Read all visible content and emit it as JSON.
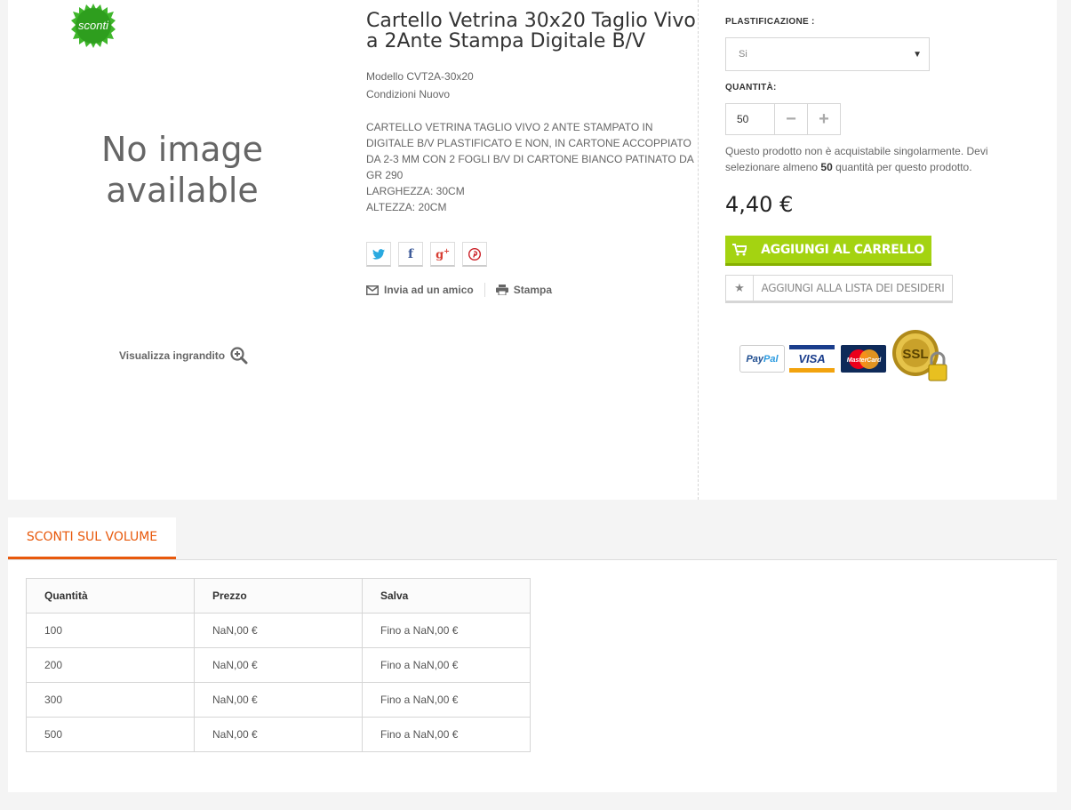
{
  "product": {
    "badge_text": "sconti",
    "no_image_line1": "No image",
    "no_image_line2": "available",
    "zoom_label": "Visualizza ingrandito",
    "title": "Cartello Vetrina 30x20 Taglio Vivo a 2Ante Stampa Digitale B/V",
    "model": "Modello CVT2A-30x20",
    "condition": "Condizioni Nuovo",
    "description_lines": [
      "CARTELLO VETRINA TAGLIO VIVO 2 ANTE STAMPATO IN DIGITALE B/V PLASTIFICATO E NON, IN CARTONE ACCOPPIATO DA 2-3 MM CON 2 FOGLI B/V DI CARTONE BIANCO PATINATO DA GR 290",
      "LARGHEZZA: 30CM",
      "ALTEZZA: 20CM"
    ],
    "send_friend": "Invia ad un amico",
    "print": "Stampa"
  },
  "social": [
    {
      "name": "twitter-icon",
      "glyph": "t",
      "color": "#29a9e0"
    },
    {
      "name": "facebook-icon",
      "glyph": "f",
      "color": "#3b5998"
    },
    {
      "name": "googleplus-icon",
      "glyph": "g+",
      "color": "#d73d32"
    },
    {
      "name": "pinterest-icon",
      "glyph": "P",
      "color": "#cb2027"
    }
  ],
  "buy": {
    "plastification_label": "PLASTIFICAZIONE :",
    "plastification_value": "Si",
    "quantity_label": "QUANTITÀ:",
    "quantity_value": "50",
    "note_before": "Questo prodotto non è acquistabile singolarmente. Devi selezionare almeno ",
    "note_min": "50",
    "note_after": " quantità per questo prodotto.",
    "price": "4,40 €",
    "add_to_cart": "AGGIUNGI AL CARRELLO",
    "add_to_wishlist": "AGGIUNGI ALLA LISTA DEI DESIDERI"
  },
  "payments": {
    "paypal_a": "Pay",
    "paypal_b": "Pal",
    "visa": "VISA",
    "mastercard": "MasterCard",
    "ssl": "SSL"
  },
  "volume": {
    "tab_label": "SCONTI SUL VOLUME",
    "headers": [
      "Quantità",
      "Prezzo",
      "Salva"
    ],
    "rows": [
      [
        "100",
        "NaN,00 €",
        "Fino a NaN,00 €"
      ],
      [
        "200",
        "NaN,00 €",
        "Fino a NaN,00 €"
      ],
      [
        "300",
        "NaN,00 €",
        "Fino a NaN,00 €"
      ],
      [
        "500",
        "NaN,00 €",
        "Fino a NaN,00 €"
      ]
    ]
  },
  "colors": {
    "accent": "#e8590c",
    "cart_green": "#a4d311"
  }
}
